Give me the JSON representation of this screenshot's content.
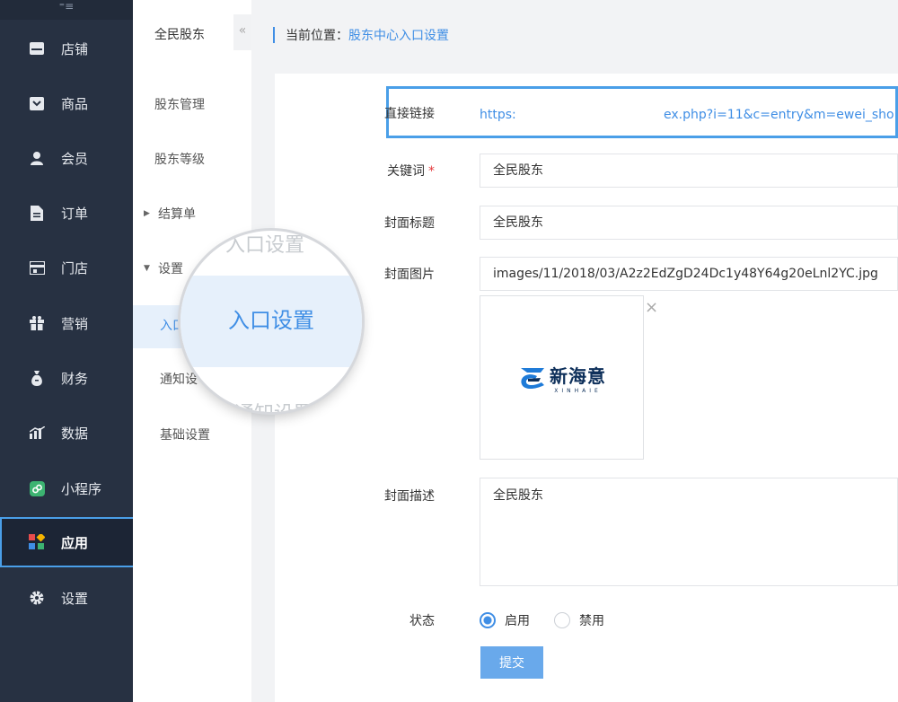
{
  "nav": {
    "collapse_glyph": "⁼≡",
    "items": [
      {
        "label": "店铺",
        "icon": "store-icon"
      },
      {
        "label": "商品",
        "icon": "goods-icon"
      },
      {
        "label": "会员",
        "icon": "member-icon"
      },
      {
        "label": "订单",
        "icon": "order-icon"
      },
      {
        "label": "门店",
        "icon": "shop-icon"
      },
      {
        "label": "营销",
        "icon": "gift-icon"
      },
      {
        "label": "财务",
        "icon": "money-bag-icon"
      },
      {
        "label": "数据",
        "icon": "chart-icon"
      },
      {
        "label": "小程序",
        "icon": "miniprogram-icon"
      },
      {
        "label": "应用",
        "icon": "apps-icon"
      },
      {
        "label": "设置",
        "icon": "gear-icon"
      }
    ],
    "active": "应用"
  },
  "subnav": {
    "title": "全民股东",
    "collapse_glyph": "«",
    "items": [
      "股东管理",
      "股东等级"
    ],
    "group_settlement": "结算单",
    "group_settings": "设置",
    "settings_items": [
      "入口设置",
      "通知设置",
      "基础设置"
    ],
    "settings_items_visible": [
      "入口",
      "通知设"
    ],
    "active": "入口设置"
  },
  "breadcrumb": {
    "prefix": "当前位置：",
    "current": "股东中心入口设置"
  },
  "form": {
    "link_label": "直接链接",
    "link_value_start": "https:",
    "link_value_end": "ex.php?i=11&c=entry&m=ewei_sho",
    "keyword_label": "关键词",
    "keyword_required": "*",
    "keyword_value": "全民股东",
    "cover_title_label": "封面标题",
    "cover_title_value": "全民股东",
    "cover_image_label": "封面图片",
    "cover_image_value": "images/11/2018/03/A2z2EdZgD24Dc1y48Y64g20eLnl2YC.jpg",
    "image_close": "×",
    "logo_text": "新海意",
    "logo_sub": "XINHAIE",
    "cover_desc_label": "封面描述",
    "cover_desc_value": "全民股东",
    "status_label": "状态",
    "status_on": "启用",
    "status_off": "禁用",
    "status_selected": "启用",
    "submit": "提交"
  },
  "magnifier": {
    "text": "入口设置",
    "ghost_top": "入口设置",
    "ghost_bottom": "通知设置"
  },
  "colors": {
    "sidebar": "#273142",
    "accent": "#3f8ee5",
    "highlight": "#4a9fe8",
    "submit": "#69a9eb"
  }
}
